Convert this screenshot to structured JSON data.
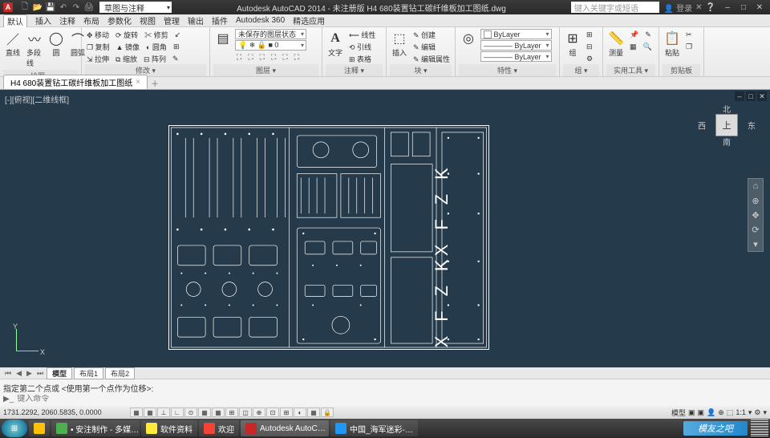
{
  "app": {
    "icon_letter": "A",
    "workspace": "草图与注释",
    "title": "Autodesk AutoCAD 2014 - 未注册版    H4 680装置钻工碳纤维板加工图纸.dwg",
    "search_placeholder": "键入关键字或短语",
    "user": "登录",
    "min": "–",
    "max": "□",
    "close": "✕"
  },
  "qat": [
    "🗋",
    "📂",
    "💾",
    "↶",
    "↷",
    "🖨"
  ],
  "menu": [
    "默认",
    "插入",
    "注释",
    "布局",
    "参数化",
    "视图",
    "管理",
    "输出",
    "插件",
    "Autodesk 360",
    "精选应用"
  ],
  "ribbon": {
    "draw": {
      "title": "绘图 ▾",
      "line": "直线",
      "polyline": "多段线",
      "circle": "圆",
      "arc": "圆弧",
      "icons": [
        "⬚",
        "◯",
        "⟋",
        "∿",
        "◇",
        "⬭",
        "░",
        "⌒"
      ]
    },
    "modify": {
      "title": "修改 ▾",
      "rows": [
        [
          "✥ 移动",
          "⟳ 旋转",
          "✂ 修剪",
          "↙"
        ],
        [
          "❐ 复制",
          "▲ 镜像",
          "◐ 圆角",
          "⊞"
        ],
        [
          "⇲ 拉伸",
          "⧉ 缩放",
          "⊟ 阵列",
          "✎"
        ]
      ]
    },
    "layer": {
      "title": "图层 ▾",
      "unsaved": "未保存的图层状态",
      "current": "💡 ❄ 🔒 ■ 0",
      "icons": [
        "⛶",
        "⛶",
        "⛶",
        "⛶",
        "⛶",
        "⛶",
        "⛶",
        "⛶",
        "⛶"
      ]
    },
    "anno": {
      "title": "注释 ▾",
      "text_big": "A",
      "text": "文字",
      "rows": [
        "⟵ 线性",
        "⟲ 引线",
        "⊞ 表格"
      ]
    },
    "block": {
      "title": "块 ▾",
      "insert": "插入",
      "insert_ico": "⬚",
      "rows": [
        "✎ 创建",
        "✎ 编辑",
        "✎ 编辑属性"
      ]
    },
    "prop": {
      "title": "特性 ▾",
      "color": "ByLayer",
      "ltype": "———— ByLayer",
      "lweight": "———— ByLayer",
      "match": "◎",
      "icons": [
        "▤",
        "▤",
        "▤"
      ]
    },
    "group": {
      "title": "组 ▾",
      "big": "组",
      "ico": "⊞",
      "icons": [
        "⊞",
        "⊟",
        "⚙"
      ]
    },
    "util": {
      "title": "实用工具 ▾",
      "measure": "测量",
      "ico": "📏",
      "icons": [
        "📌",
        "✎",
        "▦",
        "🔍"
      ]
    },
    "clip": {
      "title": "剪贴板",
      "paste": "粘贴",
      "ico": "📋",
      "icons": [
        "✂",
        "❐"
      ]
    }
  },
  "file_tab": {
    "name": "H4 680装置钻工碳纤维板加工图纸",
    "close": "×",
    "plus": "＋"
  },
  "viewport": {
    "label": "[-][俯视][二维线框]",
    "min": "–",
    "max": "□",
    "close": "✕"
  },
  "viewcube": {
    "n": "北",
    "s": "南",
    "e": "东",
    "w": "西",
    "face": "上"
  },
  "nav_icons": [
    "⌂",
    "⊕",
    "✥",
    "⟳",
    "▾"
  ],
  "ucs": {
    "x": "X",
    "y": "Y"
  },
  "layout": {
    "arrows": [
      "⏮",
      "◀",
      "▶",
      "⏭"
    ],
    "model": "模型",
    "l1": "布局1",
    "l2": "布局2"
  },
  "command": {
    "history": "指定第二个点或 <使用第一个点作为位移>:",
    "prompt": "键入命令"
  },
  "status": {
    "coords": "1731.2292, 2060.5835, 0.0000",
    "buttons": [
      "▦",
      "▦",
      "⊥",
      "∟",
      "⊙",
      "▦",
      "▦",
      "⊞",
      "◫",
      "⊕",
      "⊡",
      "⊞",
      "◐",
      "▦",
      "🔒"
    ],
    "right": [
      "模型",
      "▣",
      "▣",
      "👤",
      "⊕",
      "⬚",
      "1:1",
      "▾",
      "⚙",
      "▾"
    ]
  },
  "taskbar": {
    "start": "⊞",
    "items": [
      {
        "ico": "#ffc107",
        "label": ""
      },
      {
        "ico": "#4caf50",
        "label": "• 安注制作 - 多媒…"
      },
      {
        "ico": "#ffeb3b",
        "label": "软件资料"
      },
      {
        "ico": "#f44336",
        "label": "欢迎"
      },
      {
        "ico": "#c62828",
        "label": "Autodesk AutoC…"
      },
      {
        "ico": "#2196f3",
        "label": "中国_海军迷彩-…"
      }
    ],
    "watermark": "模友之吧"
  },
  "engraving": [
    "X F Z K",
    "X F Z K"
  ]
}
